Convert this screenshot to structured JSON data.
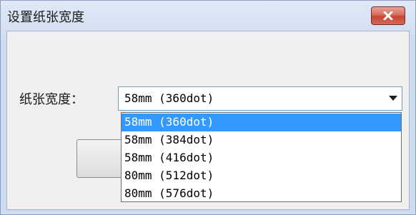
{
  "window": {
    "title": "设置纸张宽度"
  },
  "form": {
    "paper_width_label": "纸张宽度：",
    "selected_value": "58mm (360dot)"
  },
  "dropdown": {
    "options": [
      {
        "label": "58mm (360dot)",
        "selected": true
      },
      {
        "label": "58mm (384dot)",
        "selected": false
      },
      {
        "label": "58mm (416dot)",
        "selected": false
      },
      {
        "label": "80mm (512dot)",
        "selected": false
      },
      {
        "label": "80mm (576dot)",
        "selected": false
      }
    ]
  },
  "colors": {
    "selection": "#3399ff",
    "close_button": "#c74433"
  },
  "icons": {
    "close": "close-icon",
    "dropdown": "chevron-down-icon"
  }
}
